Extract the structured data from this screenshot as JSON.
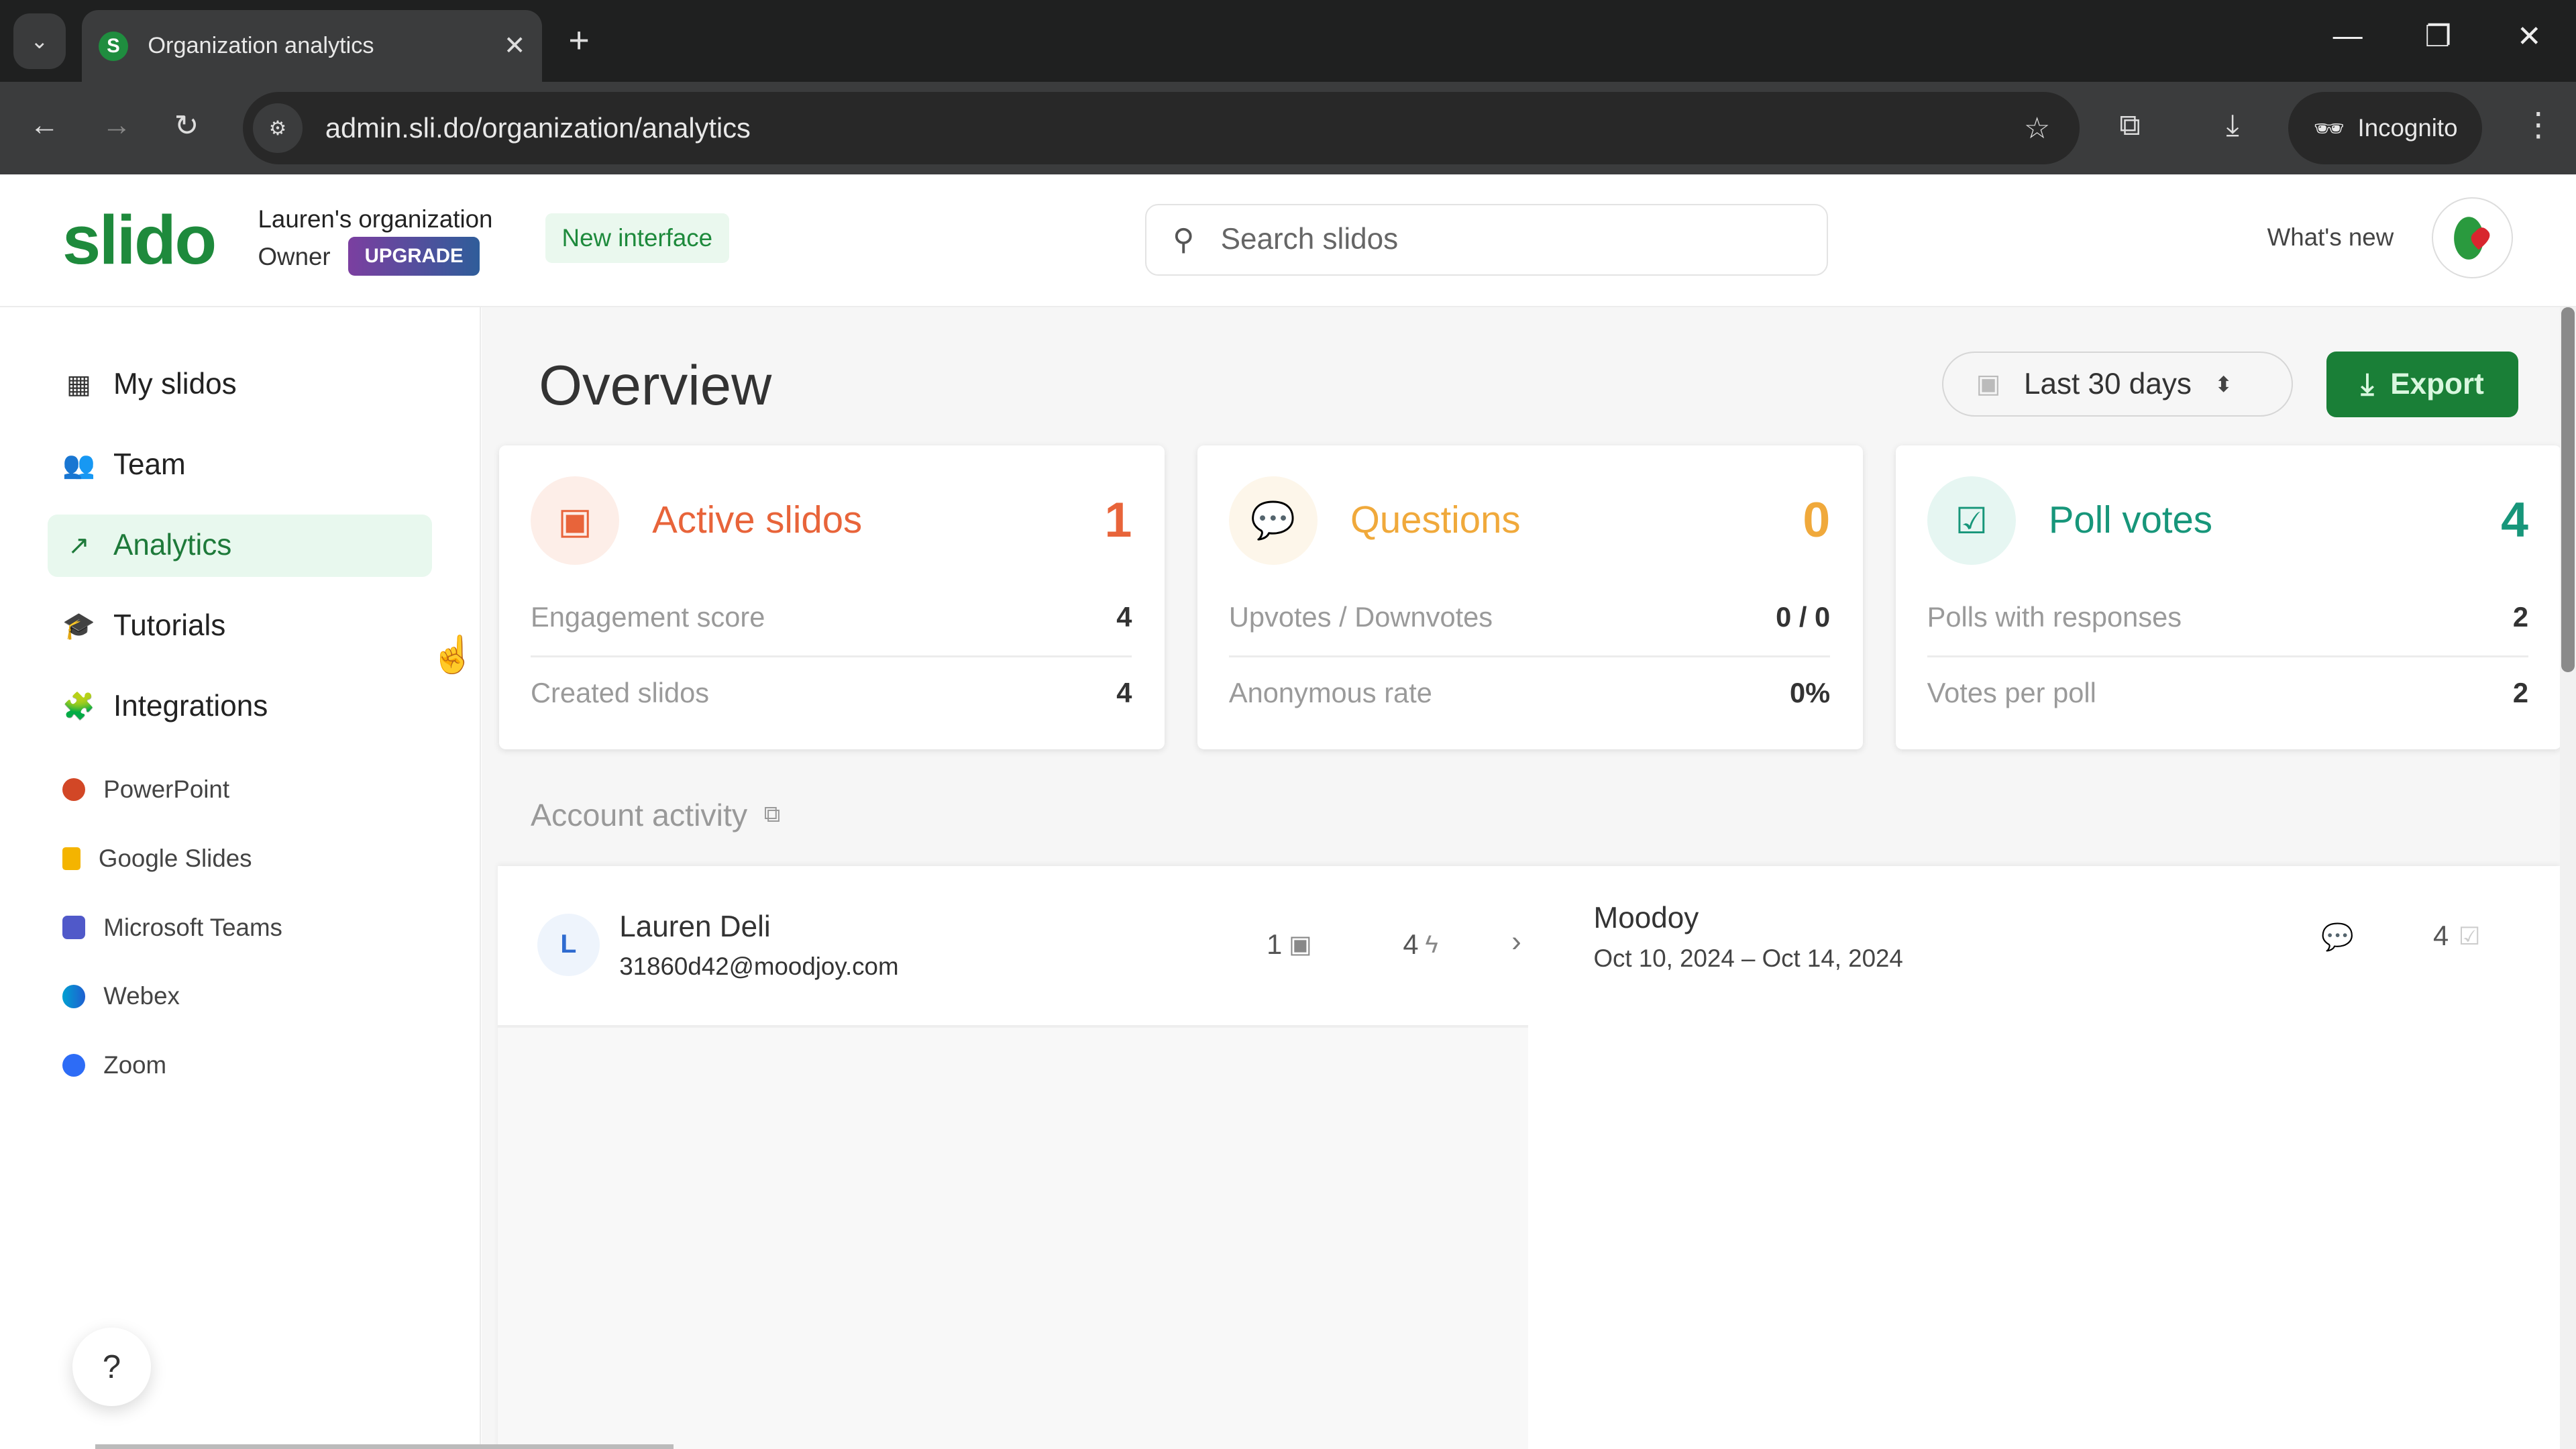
{
  "browser": {
    "tab_title": "Organization analytics",
    "tab_favicon_letter": "S",
    "url": "admin.sli.do/organization/analytics",
    "profile_label": "Incognito",
    "icons": {
      "tab_search": "chevron-down-icon",
      "close_tab": "close-icon",
      "new_tab": "plus-icon",
      "back": "arrow-left-icon",
      "forward": "arrow-right-icon",
      "reload": "reload-icon",
      "site_info": "tune-icon",
      "bookmark": "star-icon",
      "extensions": "puzzle-icon",
      "downloads": "download-icon",
      "incognito": "incognito-icon",
      "menu": "kebab-icon"
    }
  },
  "header": {
    "logo": "slido",
    "org_name": "Lauren's organization",
    "role": "Owner",
    "upgrade_label": "UPGRADE",
    "new_interface_label": "New interface",
    "search_placeholder": "Search slidos",
    "whats_new_label": "What's new"
  },
  "sidebar": {
    "items": [
      {
        "label": "My slidos",
        "icon": "calendar-icon",
        "active": false
      },
      {
        "label": "Team",
        "icon": "users-icon",
        "active": false
      },
      {
        "label": "Analytics",
        "icon": "trend-up-icon",
        "active": true
      },
      {
        "label": "Tutorials",
        "icon": "graduation-cap-icon",
        "active": false
      },
      {
        "label": "Integrations",
        "icon": "puzzle-icon",
        "active": false
      }
    ],
    "integrations": [
      {
        "label": "PowerPoint",
        "color": "#d24726"
      },
      {
        "label": "Google Slides",
        "color": "#f4b400"
      },
      {
        "label": "Microsoft Teams",
        "color": "#5059c9"
      },
      {
        "label": "Webex",
        "color": "#00a0d1"
      },
      {
        "label": "Zoom",
        "color": "#2d6cf6"
      }
    ],
    "help_label": "?"
  },
  "main": {
    "title": "Overview",
    "date_range": "Last 30 days",
    "export_label": "Export",
    "cards": [
      {
        "title": "Active slidos",
        "value": "1",
        "color": "#e8643a",
        "bg": "#fdeee8",
        "rows": [
          {
            "label": "Engagement score",
            "value": "4"
          },
          {
            "label": "Created slidos",
            "value": "4"
          }
        ]
      },
      {
        "title": "Questions",
        "value": "0",
        "color": "#f0a93b",
        "bg": "#fdf6ea",
        "rows": [
          {
            "label": "Upvotes / Downvotes",
            "value": "0 / 0"
          },
          {
            "label": "Anonymous rate",
            "value": "0%"
          }
        ]
      },
      {
        "title": "Poll votes",
        "value": "4",
        "color": "#17967a",
        "bg": "#e6f6f2",
        "rows": [
          {
            "label": "Polls with responses",
            "value": "2"
          },
          {
            "label": "Votes per poll",
            "value": "2"
          }
        ]
      }
    ],
    "activity": {
      "title": "Account activity",
      "user": {
        "initial": "L",
        "name": "Lauren Deli",
        "email": "31860d42@moodjoy.com",
        "slidos_count": "1",
        "engagement_count": "4"
      },
      "event": {
        "name": "Moodoy",
        "dates": "Oct 10, 2024 – Oct 14, 2024",
        "poll_votes": "4"
      }
    }
  }
}
